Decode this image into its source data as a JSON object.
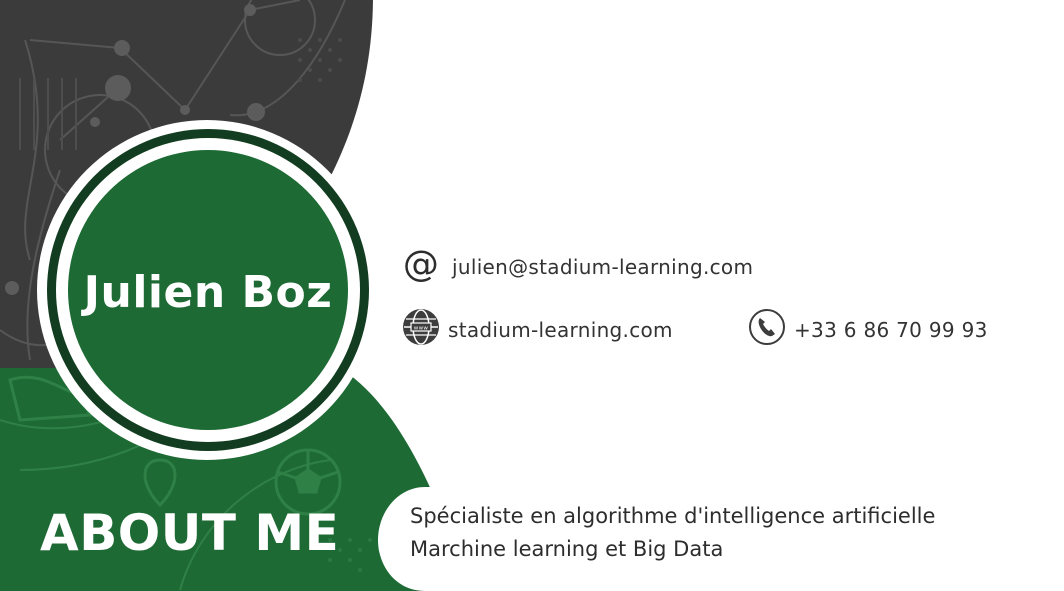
{
  "card": {
    "name": "Julien Boz",
    "about_title": "ABOUT ME",
    "about_lines": [
      "Spécialiste en algorithme d'intelligence artificielle",
      "Marchine learning et Big Data"
    ]
  },
  "contact": {
    "email": "julien@stadium-learning.com",
    "website": "stadium-learning.com",
    "phone": "+33 6 86 70 99 93"
  },
  "icons": {
    "email": "at-sign-icon",
    "website": "globe-icon",
    "phone": "phone-icon",
    "background": [
      "network-lines-decoration",
      "soccer-ball-icon",
      "location-pin-icon",
      "sneaker-icon"
    ]
  },
  "colors": {
    "dark_panel": "#3b3b3b",
    "green": "#1d6a34",
    "dark_green_ring": "#133d20",
    "white": "#ffffff",
    "text": "#333333"
  }
}
